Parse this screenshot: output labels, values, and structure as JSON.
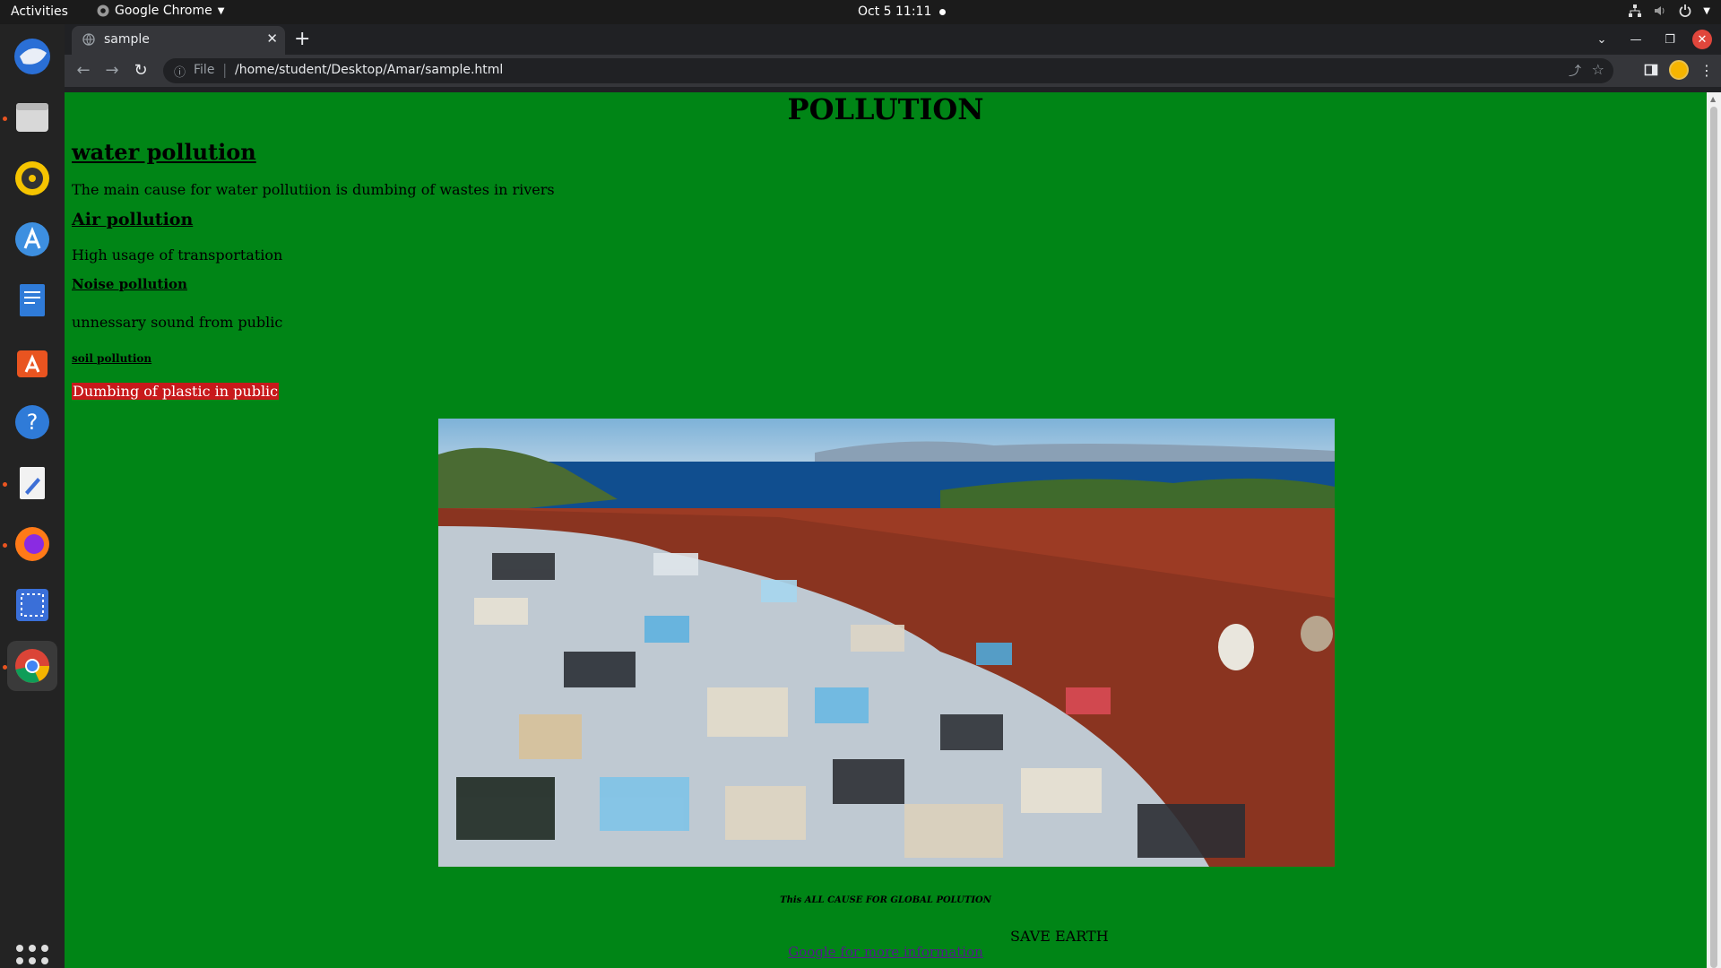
{
  "system": {
    "activities": "Activities",
    "app_name": "Google Chrome",
    "clock": "Oct 5  11:11"
  },
  "browser": {
    "tab_title": "sample",
    "url_scheme": "File",
    "url": "/home/student/Desktop/Amar/sample.html"
  },
  "page": {
    "title": "POLLUTION",
    "sections": [
      {
        "heading": "water pollution",
        "text": "The main cause for water pollutiion is dumbing of wastes in rivers"
      },
      {
        "heading": "Air pollution",
        "text": "High usage of transportation"
      },
      {
        "heading": "Noise pollution",
        "text": "unnessary sound from public"
      },
      {
        "heading": "soil pollution",
        "text": "Dumbing of plastic in public"
      }
    ],
    "caption": "This ALL CAUSE FOR GLOBAL POLUTION",
    "save_text": "SAVE EARTH",
    "link_text": "Google for more information",
    "colors": {
      "background": "#008516",
      "highlight": "#c8191b",
      "link": "#551a8b"
    }
  },
  "dock_items": [
    "thunderbird-icon",
    "files-icon",
    "rhythmbox-icon",
    "app-center-icon",
    "writer-icon",
    "software-icon",
    "help-icon",
    "text-editor-icon",
    "firefox-icon",
    "screenshot-icon",
    "chrome-icon"
  ]
}
